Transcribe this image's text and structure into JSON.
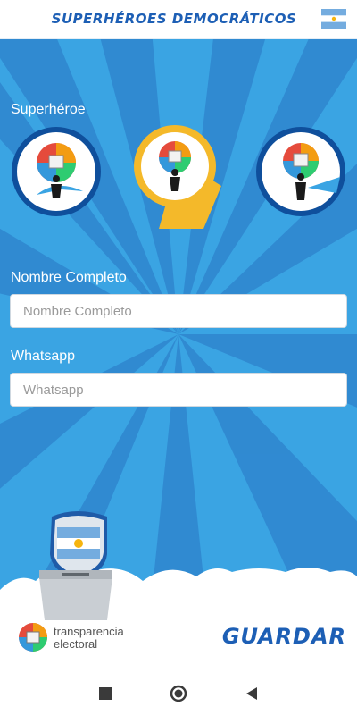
{
  "header": {
    "title": "SUPERHÉROES DEMOCRÁTICOS",
    "flag_icon": "argentina-flag-icon"
  },
  "form": {
    "superhero_label": "Superhéroe",
    "avatars": [
      "superhero-avatar-1",
      "superhero-avatar-2",
      "superhero-avatar-3"
    ],
    "selected_avatar": 2,
    "name_label": "Nombre Completo",
    "name_placeholder": "Nombre Completo",
    "whatsapp_label": "Whatsapp",
    "whatsapp_placeholder": "Whatsapp"
  },
  "footer": {
    "logo_line1": "transparencia",
    "logo_line2": "electoral",
    "save_label": "GUARDAR"
  },
  "colors": {
    "accent": "#1d5fb5",
    "background": "#3aa4e3",
    "selected": "#f4b92a"
  },
  "nav": [
    "stop-icon",
    "home-icon",
    "back-icon"
  ]
}
